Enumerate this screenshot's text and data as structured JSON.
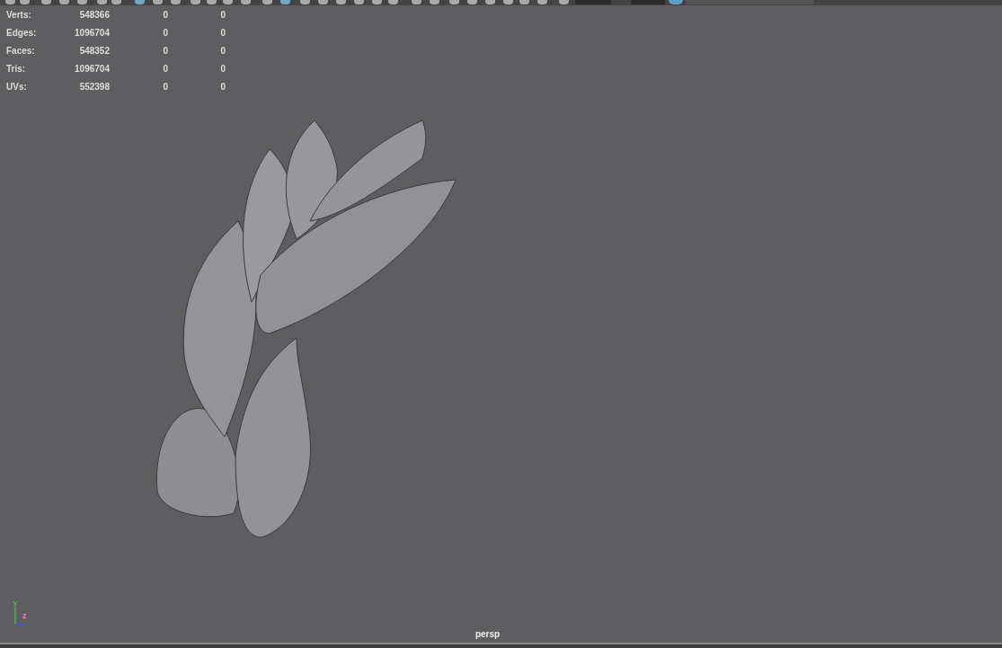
{
  "heads_up_display": {
    "rows": [
      {
        "label": "Verts:",
        "value": "548366",
        "column_3": "0",
        "column_4": "0"
      },
      {
        "label": "Edges:",
        "value": "1096704",
        "column_3": "0",
        "column_4": "0"
      },
      {
        "label": "Faces:",
        "value": "548352",
        "column_3": "0",
        "column_4": "0"
      },
      {
        "label": "Tris:",
        "value": "1096704",
        "column_3": "0",
        "column_4": "0"
      },
      {
        "label": "UVs:",
        "value": "552398",
        "column_3": "0",
        "column_4": "0"
      }
    ]
  },
  "viewport": {
    "axis_indicator": {
      "y_label": "y",
      "z_label": "z"
    },
    "camera_label": "persp"
  }
}
